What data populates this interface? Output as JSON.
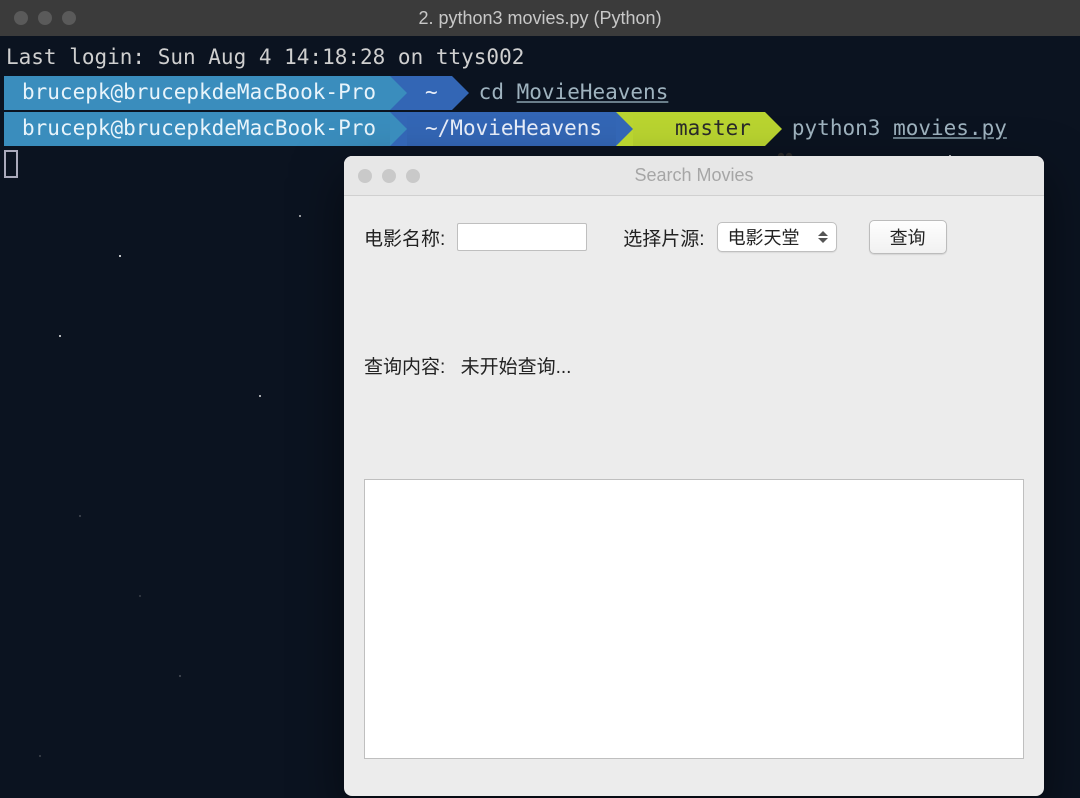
{
  "terminal": {
    "title": "2. python3 movies.py (Python)",
    "login_line": "Last login: Sun Aug  4 14:18:28 on ttys002",
    "host": "brucepk@brucepkdeMacBook-Pro",
    "line1": {
      "path": "~",
      "cmd_bin": "cd",
      "cmd_arg": "MovieHeavens"
    },
    "line2": {
      "path": "~/MovieHeavens",
      "branch": "master",
      "cmd_bin": "python3",
      "cmd_arg": "movies.py"
    }
  },
  "app": {
    "title": "Search Movies",
    "movie_name_label": "电影名称:",
    "movie_name_value": "",
    "source_label": "选择片源:",
    "source_selected": "电影天堂",
    "search_button": "查询",
    "status_label": "查询内容:",
    "status_value": "未开始查询..."
  }
}
